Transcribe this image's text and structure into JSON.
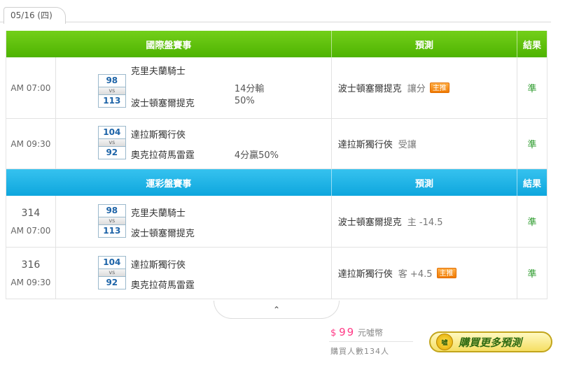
{
  "date_tab": "05/16 (四)",
  "section1": {
    "header": {
      "game": "國際盤賽事",
      "prediction": "預測",
      "result": "結果"
    },
    "rows": [
      {
        "time": "AM 07:00",
        "away_score": "98",
        "vs": "vs",
        "home_score": "113",
        "away_team": "克里夫蘭騎士",
        "home_team": "波士頓塞爾提克",
        "line_top": "14分輸",
        "line_bottom": "50%",
        "pick_team": "波士頓塞爾提克",
        "pick_note": "讓分",
        "badge": "主推",
        "result": "準"
      },
      {
        "time": "AM 09:30",
        "away_score": "104",
        "vs": "vs",
        "home_score": "92",
        "away_team": "達拉斯獨行俠",
        "home_team": "奧克拉荷馬雷霆",
        "line_bottom": "4分贏50%",
        "pick_team": "達拉斯獨行俠",
        "pick_note": "受讓",
        "result": "準"
      }
    ]
  },
  "section2": {
    "header": {
      "game": "運彩盤賽事",
      "prediction": "預測",
      "result": "結果"
    },
    "rows": [
      {
        "num": "314",
        "time": "AM 07:00",
        "away_score": "98",
        "vs": "vs",
        "home_score": "113",
        "away_team": "克里夫蘭騎士",
        "home_team": "波士頓塞爾提克",
        "pick_team": "波士頓塞爾提克",
        "pick_note": "主 -14.5",
        "result": "準"
      },
      {
        "num": "316",
        "time": "AM 09:30",
        "away_score": "104",
        "vs": "vs",
        "home_score": "92",
        "away_team": "達拉斯獨行俠",
        "home_team": "奧克拉荷馬雷霆",
        "pick_team": "達拉斯獨行俠",
        "pick_note": "客 +4.5",
        "badge": "主推",
        "result": "準"
      }
    ]
  },
  "collapse_icon": "chevron-up-icon",
  "collapse_glyph": "⌃",
  "price": {
    "symbol": "$",
    "amount": "99",
    "unit": "元噓幣"
  },
  "buyers": "購買人數134人",
  "buy_button": {
    "icon_text": "噓",
    "label": "購買更多預測"
  },
  "colors": {
    "green_header": "#4eb301",
    "blue_header": "#0ea6dd",
    "result_green": "#2a9a2a",
    "price_pink": "#ff3a86",
    "badge_orange": "#f07a00"
  }
}
